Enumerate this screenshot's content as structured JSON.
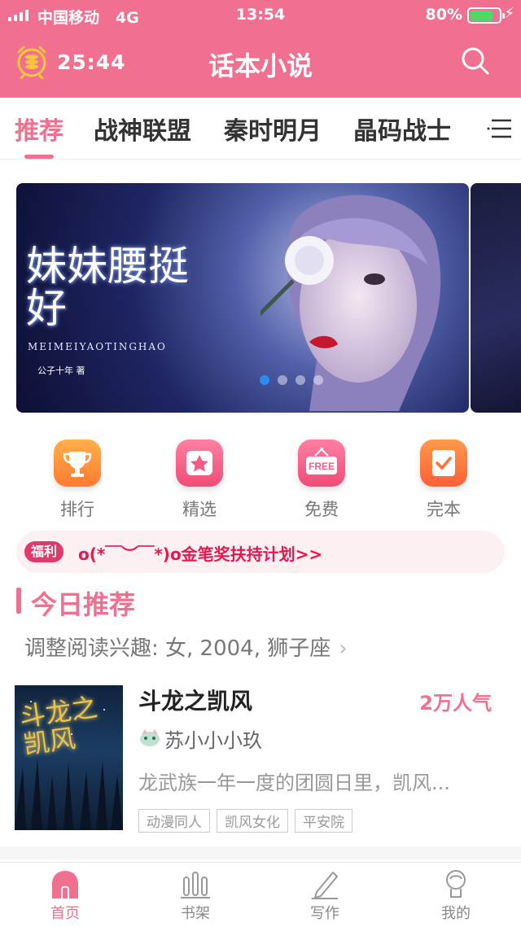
{
  "status_bar": {
    "carrier": "中国移动",
    "network": "4G",
    "time": "13:54",
    "battery": "80%",
    "battery_level": 0.8
  },
  "header": {
    "timer": "25:44",
    "title": "话本小说",
    "search_icon": "search-icon",
    "alarm_icon": "alarm-clock-coins-icon"
  },
  "tabs": [
    {
      "label": "推荐",
      "active": true
    },
    {
      "label": "战神联盟"
    },
    {
      "label": "秦时明月"
    },
    {
      "label": "晶码战士"
    }
  ],
  "banner": {
    "title": "妹妹腰挺好",
    "pinyin": "MEIMEIYAOTINGHAO",
    "author": "公子十年 著",
    "slide_count": 4,
    "active_slide": 1
  },
  "categories": [
    {
      "label": "排行",
      "icon": "trophy-icon",
      "color": "#ff8a3d"
    },
    {
      "label": "精选",
      "icon": "star-icon",
      "color": "#f45c84"
    },
    {
      "label": "免费",
      "icon": "free-tag-icon",
      "badge": "FREE",
      "color": "#f45c84"
    },
    {
      "label": "完本",
      "icon": "check-book-icon",
      "color": "#ff7040"
    }
  ],
  "welfare": {
    "badge": "福利",
    "text": "o(*￣︶￣*)o金笔奖扶持计划>>"
  },
  "recommend": {
    "section_title": "今日推荐",
    "interest": "调整阅读兴趣: 女, 2004, 狮子座",
    "chevron": "›"
  },
  "book": {
    "cover_title": "斗龙之凯风",
    "title": "斗龙之凯风",
    "popularity": "2万人气",
    "author": "苏小小小玖",
    "description": "龙武族一年一度的团圆日里，凯风...",
    "tags": [
      "动漫同人",
      "凯风女化",
      "平安院"
    ]
  },
  "bottom_nav": [
    {
      "label": "首页",
      "icon": "home-icon",
      "active": true
    },
    {
      "label": "书架",
      "icon": "bookshelf-icon"
    },
    {
      "label": "写作",
      "icon": "pen-icon"
    },
    {
      "label": "我的",
      "icon": "profile-icon"
    }
  ],
  "colors": {
    "brand": "#f2708f",
    "accent_red": "#e8174d",
    "battery_green": "#4cd964"
  }
}
